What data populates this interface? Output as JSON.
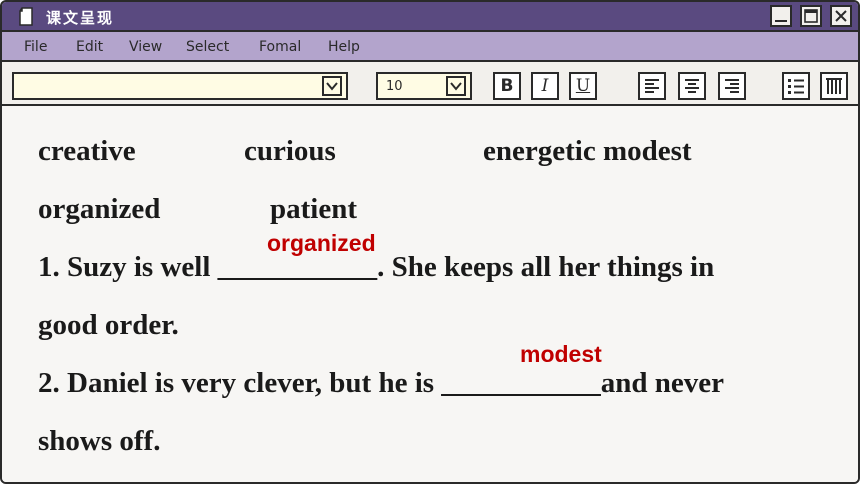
{
  "window": {
    "title": "课文呈现"
  },
  "menu": [
    "File",
    "Edit",
    "View",
    "Select",
    "Fomal",
    "Help"
  ],
  "toolbar": {
    "font_value": "",
    "size_value": "10",
    "bold_label": "B",
    "italic_label": "I",
    "underline_label": "U"
  },
  "word_bank": [
    "creative",
    "curious",
    "energetic modest",
    "organized",
    "patient"
  ],
  "sentences": [
    {
      "number": "1.",
      "before": "Suzy is well ",
      "blank": "___________",
      "after": ". She keeps all her things in",
      "continuation": "good order.",
      "answer": "organized"
    },
    {
      "number": "2.",
      "before": "Daniel is very clever, but he is ",
      "blank": "___________",
      "after": "and never",
      "continuation": "shows off.",
      "answer": "modest"
    }
  ],
  "colors": {
    "title_bar": "#5a4a80",
    "menu_bar": "#b3a4cc",
    "answer_text": "#c00000",
    "input_bg": "#fffce4"
  }
}
